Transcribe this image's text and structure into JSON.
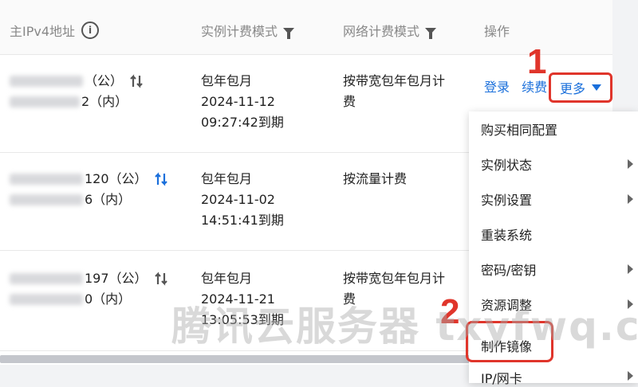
{
  "header": {
    "ip_label": "主IPv4地址",
    "instance_billing": "实例计费模式",
    "network_billing": "网络计费模式",
    "actions": "操作"
  },
  "rows": [
    {
      "ip_public_suffix": "（公）",
      "ip_private_suffix": "2（内）",
      "billing_lines": [
        "包年包月",
        "2024-11-12",
        "09:27:42到期"
      ],
      "network_lines": [
        "按带宽包年包月计",
        "费"
      ]
    },
    {
      "ip_public_suffix": "120（公）",
      "ip_private_suffix": "6（内）",
      "billing_lines": [
        "包年包月",
        "2024-11-02",
        "14:51:41到期"
      ],
      "network_lines": [
        "按流量计费"
      ]
    },
    {
      "ip_public_suffix": "197（公）",
      "ip_private_suffix": "0（内）",
      "billing_lines": [
        "包年包月",
        "2024-11-21",
        "13:05:53到期"
      ],
      "network_lines": [
        "按带宽包年包月计",
        "费"
      ]
    }
  ],
  "actions": {
    "login": "登录",
    "renew": "续费",
    "more": "更多"
  },
  "annotations": {
    "step1": "1",
    "step2": "2"
  },
  "menu": {
    "items": [
      {
        "label": "购买相同配置",
        "has_submenu": false
      },
      {
        "label": "实例状态",
        "has_submenu": true
      },
      {
        "label": "实例设置",
        "has_submenu": true
      },
      {
        "label": "重装系统",
        "has_submenu": false
      },
      {
        "label": "密码/密钥",
        "has_submenu": true
      },
      {
        "label": "资源调整",
        "has_submenu": true
      },
      {
        "label": "制作镜像",
        "has_submenu": false
      },
      {
        "label": "IP/网卡",
        "has_submenu": true
      }
    ]
  },
  "watermark": "腾讯云服务器 txyfwq.com",
  "colors": {
    "link": "#1a6fdb",
    "annotation_red": "#e0352b",
    "swap_icon_active": "#1a6fdb",
    "swap_icon_default": "#555555"
  }
}
